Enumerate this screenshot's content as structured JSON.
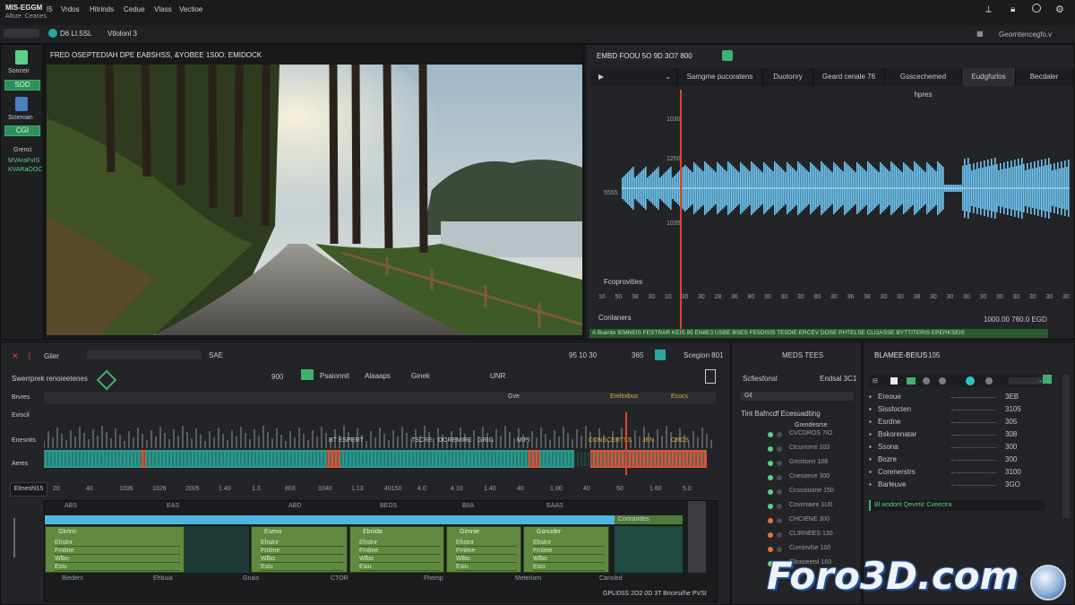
{
  "menubar": {
    "app_title": "MIS-EGGM",
    "app_subtitle": "Allure. Ceanes",
    "items": [
      "I5",
      "Vrdos",
      "Hitrinds",
      "Cedue",
      "Vlass",
      "Vectioe"
    ],
    "right_icons": [
      "pin-icon",
      "lock-icon",
      "search-icon",
      "settings-icon"
    ]
  },
  "toolbar": {
    "left_field": "D6 LI.5SL",
    "left_field2": "Vtlolonl 3",
    "right_label": "Georntencegfo.v"
  },
  "sidebar": {
    "items": [
      {
        "label": "Sonceir",
        "button": "SOD"
      },
      {
        "label": "Scieroan",
        "button": "CGI"
      }
    ],
    "footer_text": [
      "Grenci",
      "MVAraFvIS",
      "KVARaOOC"
    ]
  },
  "viewer": {
    "title": "FRED OSEPTEDIAH DPE EABSHSS, &YOBEE 1S0O: EMIDOCK"
  },
  "waveform": {
    "title": "EMBD FOOU 5O 9D 3O7 800",
    "tabs": [
      "Samgme pucoratens",
      "Duotonry",
      "Geard cenale 76",
      "Gsscechemed hpres",
      "Eudgfurlos",
      "Becdaler"
    ],
    "y_labels": [
      "1030",
      "1250",
      "5555",
      "1035"
    ],
    "x_labels": [
      "10",
      "50",
      "38",
      "30",
      "10",
      "30",
      "30",
      "28",
      "36",
      "80",
      "30",
      "30",
      "30",
      "80",
      "30",
      "36",
      "38",
      "30",
      "30",
      "38",
      "30",
      "30",
      "30",
      "30",
      "30",
      "30",
      "30",
      "30",
      "30"
    ],
    "footer_left": "Fcoprovities",
    "footer_left2": "Conlaners",
    "footer_right": "1000.00 760.0 EGD",
    "status_bar": "A Buente IEMNEIS FESTRAR KEIS 95  EN8E3  USBE BSES FE5DISIS TE5DIE ERCEV DOSE PHTELSE  CLI2ASSE BYTTITERIS EPERKSEIS"
  },
  "timeline": {
    "search_label": "Glier",
    "toolbar_label": "SAE",
    "mid_label": "95 10  30",
    "counter": "365",
    "right_label": "Scegion 801",
    "track_title": "Swerrprek renoieetenes",
    "track_count": "900",
    "buttons": [
      "Psaionnit",
      "Alaaaps",
      "Ginek",
      "UNR"
    ],
    "track_labels": [
      "Brvres",
      "Eviscil",
      "Enesnits",
      "Aeres"
    ],
    "marker_labels": [
      "Gve",
      "Ereltnibus",
      "Ecocs"
    ],
    "clip_labels": [
      "BT ESPERT",
      "TSCRE",
      "DOREMIRE",
      "GRIG",
      "MIPI",
      "CONSCERTSS",
      "JEN",
      "CROS"
    ],
    "ruler": [
      "20",
      "40",
      "1006",
      "1026",
      "2005",
      "1.40",
      "1.3",
      "803",
      "1040",
      "1.13",
      "40150",
      "4.0",
      "4.10",
      "1.40",
      "40",
      "1.00",
      "40",
      "50",
      "1.60",
      "5.0"
    ],
    "left_btn": "Elmeshl15"
  },
  "mixer": {
    "headers": [
      "ABS",
      "EAS",
      "ABD",
      "BEDS",
      "BIIA",
      "EAAS"
    ],
    "modules": [
      "Gkrinn",
      "Esevo",
      "Ebriida",
      "Gimnie",
      "Ganuder"
    ],
    "module_rows": [
      "Ehstnr",
      "Fmlme",
      "Wlbo",
      "Esiu"
    ],
    "preset_label": "Cortrandes",
    "footer": [
      "Bieders",
      "Ehbuia",
      "Gnais",
      "CTOR",
      "Fhemp",
      "Meteriam",
      "Carisled"
    ],
    "footer_right": "GPLI0SS 2O2 0D 3T Bricirsi/he PVSI"
  },
  "props": {
    "title": "MEDS TEES",
    "sub_left": "Scfiesfonsl",
    "sub_right": "Endsal 3C1",
    "dropdown": "Gil",
    "section": "Tint Bafncdf Ecesuadting",
    "header": "Grendesrse",
    "rows": [
      "CVCDROS 7IO",
      "Ctcurrorre 103",
      "Gricitionn 108",
      "Cnesoeve 300",
      "Ccsssiuone 150",
      "Coveniaee 1U0",
      "CHCIENE 300",
      "CLIRNEES 130",
      "Cuminvlse 100",
      "Gboioeetsl 160"
    ]
  },
  "layers": {
    "title": "BLAMEE-BEIUS",
    "count": "105",
    "rows": [
      {
        "name": "Ereoue",
        "value": "3EB"
      },
      {
        "name": "Sissfocten",
        "value": "3105"
      },
      {
        "name": "Esrdne",
        "value": "305"
      },
      {
        "name": "Bskorenatar",
        "value": "308"
      },
      {
        "name": "Ssona",
        "value": "300"
      },
      {
        "name": "Bozre",
        "value": "300"
      },
      {
        "name": "Corenerstrs",
        "value": "3100"
      },
      {
        "name": "Barleuve",
        "value": "3GO"
      }
    ],
    "footer": "Bl.wodorit Qevetic Cveectra"
  },
  "watermark": "Foro3D.com",
  "colors": {
    "accent_green": "#3fb06f",
    "waveform_blue": "#6ec6f2",
    "clip_teal": "#2b9a8f",
    "clip_red": "#d3583f",
    "playhead_red": "#e0442f"
  }
}
